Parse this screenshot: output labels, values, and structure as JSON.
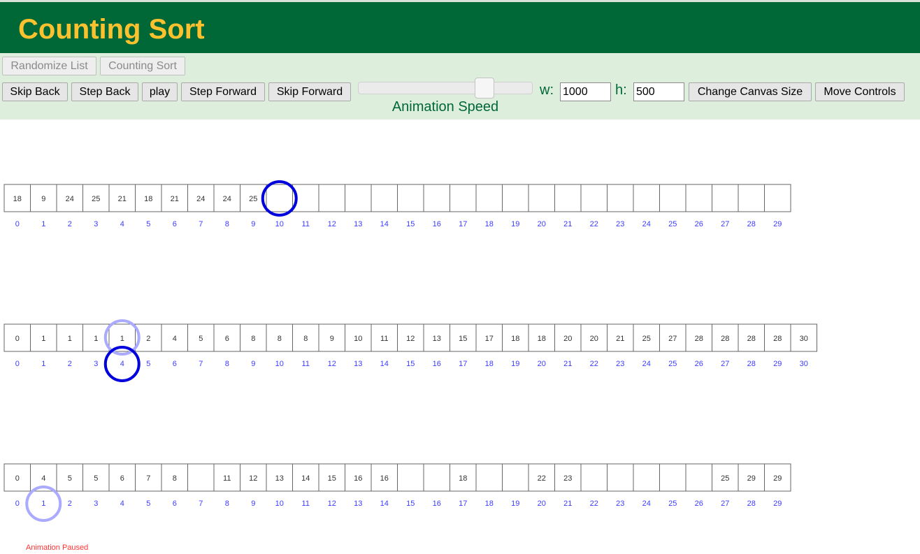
{
  "app": {
    "title": "Counting Sort"
  },
  "toolbar_row1": [
    {
      "key": "randomize",
      "label": "Randomize List",
      "disabled": true
    },
    {
      "key": "counting_sort",
      "label": "Counting Sort",
      "disabled": true
    }
  ],
  "toolbar_row2": {
    "skip_back": "Skip Back",
    "step_back": "Step Back",
    "play": "play",
    "step_forward": "Step Forward",
    "skip_forward": "Skip Forward",
    "speed_label": "Animation Speed",
    "speed_level": 0.75,
    "width_label": "w:",
    "width_value": "1000",
    "height_label": "h:",
    "height_value": "500",
    "change_canvas": "Change Canvas Size",
    "move_controls": "Move Controls"
  },
  "arrays": {
    "input": {
      "values": [
        "18",
        "9",
        "24",
        "25",
        "21",
        "18",
        "21",
        "24",
        "24",
        "25",
        "",
        "",
        "",
        "",
        "",
        "",
        "",
        "",
        "",
        "",
        "",
        "",
        "",
        "",
        "",
        "",
        "",
        "",
        "",
        ""
      ],
      "indices": [
        "0",
        "1",
        "2",
        "3",
        "4",
        "5",
        "6",
        "7",
        "8",
        "9",
        "10",
        "11",
        "12",
        "13",
        "14",
        "15",
        "16",
        "17",
        "18",
        "19",
        "20",
        "21",
        "22",
        "23",
        "24",
        "25",
        "26",
        "27",
        "28",
        "29"
      ],
      "highlight_dark_index": 10
    },
    "count": {
      "values": [
        "0",
        "1",
        "1",
        "1",
        "1",
        "2",
        "4",
        "5",
        "6",
        "8",
        "8",
        "8",
        "9",
        "10",
        "11",
        "12",
        "13",
        "15",
        "17",
        "18",
        "18",
        "20",
        "20",
        "21",
        "25",
        "27",
        "28",
        "28",
        "28",
        "28",
        "30"
      ],
      "indices": [
        "0",
        "1",
        "2",
        "3",
        "4",
        "5",
        "6",
        "7",
        "8",
        "9",
        "10",
        "11",
        "12",
        "13",
        "14",
        "15",
        "16",
        "17",
        "18",
        "19",
        "20",
        "21",
        "22",
        "23",
        "24",
        "25",
        "26",
        "27",
        "28",
        "29",
        "30"
      ],
      "highlight_light_index": 4,
      "highlight_dark_label_index": 4
    },
    "output": {
      "values": [
        "0",
        "4",
        "5",
        "5",
        "6",
        "7",
        "8",
        "",
        "11",
        "12",
        "13",
        "14",
        "15",
        "16",
        "16",
        "",
        "",
        "18",
        "",
        "",
        "22",
        "23",
        "",
        "",
        "",
        "",
        "",
        "25",
        "29",
        "29"
      ],
      "indices": [
        "0",
        "1",
        "2",
        "3",
        "4",
        "5",
        "6",
        "7",
        "8",
        "9",
        "10",
        "11",
        "12",
        "13",
        "14",
        "15",
        "16",
        "17",
        "18",
        "19",
        "20",
        "21",
        "22",
        "23",
        "24",
        "25",
        "26",
        "27",
        "28",
        "29"
      ],
      "highlight_light_label_index": 1
    }
  },
  "status": "Animation Paused",
  "colors": {
    "header_bg": "#006837",
    "title": "#fcc12e",
    "controls_bg": "#deeedd",
    "index_label": "#3b3bff",
    "highlight_dark": "#0000dd",
    "highlight_light": "#aaaaff",
    "status": "#ff3333"
  }
}
